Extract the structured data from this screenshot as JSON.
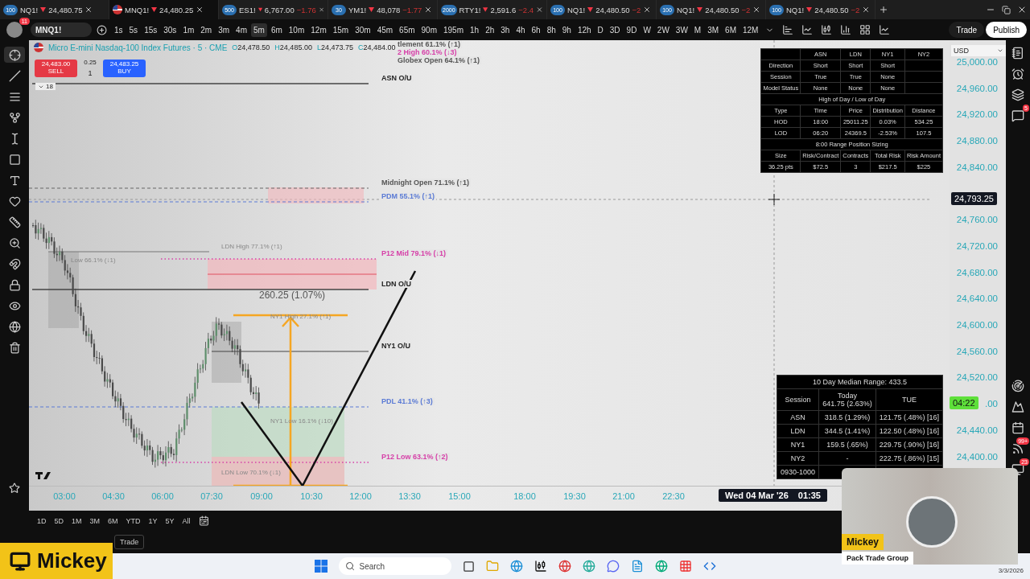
{
  "tabs": [
    {
      "badge": "100",
      "symbol": "NQ1!",
      "price": "24,480.75",
      "selected": false
    },
    {
      "symbol": "MNQ1!",
      "price": "24,480.25",
      "selected": true
    },
    {
      "badge": "500",
      "symbol": "ES1!",
      "price": "6,767.00",
      "change": "−1.76",
      "selected": false
    },
    {
      "badge": "30",
      "symbol": "YM1!",
      "price": "48,078",
      "change": "−1.77",
      "selected": false
    },
    {
      "badge": "2000",
      "symbol": "RTY1!",
      "price": "2,591.6",
      "change": "−2.4",
      "selected": false
    },
    {
      "badge": "100",
      "symbol": "NQ1!",
      "price": "24,480.50",
      "change": "−2",
      "selected": false
    },
    {
      "badge": "100",
      "symbol": "NQ1!",
      "price": "24,480.50",
      "change": "−2",
      "selected": false
    },
    {
      "badge": "100",
      "symbol": "NQ1!",
      "price": "24,480.50",
      "change": "−2",
      "selected": false
    }
  ],
  "toolbar": {
    "avatar_badge": "11",
    "symbol": "MNQ1!",
    "intervals": [
      {
        "label": "1s",
        "selected": false
      },
      {
        "label": "5s",
        "selected": false
      },
      {
        "label": "15s",
        "selected": false
      },
      {
        "label": "30s",
        "selected": false
      },
      {
        "label": "1m",
        "selected": false
      },
      {
        "label": "2m",
        "selected": false
      },
      {
        "label": "3m",
        "selected": false
      },
      {
        "label": "4m",
        "selected": false
      },
      {
        "label": "5m",
        "selected": true
      },
      {
        "label": "6m",
        "selected": false
      },
      {
        "label": "10m",
        "selected": false
      },
      {
        "label": "12m",
        "selected": false
      },
      {
        "label": "15m",
        "selected": false
      },
      {
        "label": "30m",
        "selected": false
      },
      {
        "label": "45m",
        "selected": false
      },
      {
        "label": "65m",
        "selected": false
      },
      {
        "label": "90m",
        "selected": false
      },
      {
        "label": "195m",
        "selected": false
      },
      {
        "label": "1h",
        "selected": false
      },
      {
        "label": "2h",
        "selected": false
      },
      {
        "label": "3h",
        "selected": false
      },
      {
        "label": "4h",
        "selected": false
      },
      {
        "label": "6h",
        "selected": false
      },
      {
        "label": "8h",
        "selected": false
      },
      {
        "label": "9h",
        "selected": false
      },
      {
        "label": "12h",
        "selected": false
      },
      {
        "label": "D",
        "selected": false
      },
      {
        "label": "3D",
        "selected": false
      },
      {
        "label": "9D",
        "selected": false
      },
      {
        "label": "W",
        "selected": false
      },
      {
        "label": "2W",
        "selected": false
      },
      {
        "label": "3W",
        "selected": false
      },
      {
        "label": "M",
        "selected": false
      },
      {
        "label": "3M",
        "selected": false
      },
      {
        "label": "6M",
        "selected": false
      },
      {
        "label": "12M",
        "selected": false
      }
    ],
    "trade": "Trade",
    "publish": "Publish"
  },
  "left_tools": [
    {
      "kind": "crosshair",
      "selected": true
    },
    {
      "kind": "line",
      "selected": false
    },
    {
      "kind": "lines",
      "selected": false
    },
    {
      "kind": "fork",
      "selected": false
    },
    {
      "kind": "cursor",
      "selected": false
    },
    {
      "kind": "shape",
      "selected": false
    },
    {
      "kind": "text",
      "selected": false
    },
    {
      "kind": "heart",
      "selected": false
    },
    {
      "kind": "ruler",
      "selected": false
    },
    {
      "kind": "zoom",
      "selected": false
    },
    {
      "kind": "magnet",
      "selected": false
    },
    {
      "kind": "lock",
      "selected": false
    },
    {
      "kind": "eye",
      "selected": false
    },
    {
      "kind": "globe",
      "selected": false
    },
    {
      "kind": "trash",
      "selected": false
    }
  ],
  "chart": {
    "title": "Micro E-mini Nasdaq-100 Index Futures · 5 · CME",
    "ohlc": [
      {
        "key": "O",
        "value": "24,478.50"
      },
      {
        "key": "H",
        "value": "24,485.00"
      },
      {
        "key": "L",
        "value": "24,473.75"
      },
      {
        "key": "C",
        "value": "24,484.00"
      }
    ],
    "order": {
      "sell_price": "24,483.00",
      "sell_label": "SELL",
      "spread": "0.25",
      "qty": "1",
      "buy_price": "24,483.25",
      "buy_label": "BUY"
    },
    "collapse": "18",
    "levels": [
      {
        "text": "tlement 61.1% (↑1)",
        "color": "#555555"
      },
      {
        "text": "2 High 60.1% (↓3)",
        "color": "#d63fa8"
      },
      {
        "text": "Globex Open 64.1% (↑1)",
        "color": "#555555"
      },
      {
        "text": "ASN O/U",
        "color": "#222222"
      },
      {
        "text": "Midnight Open 71.1% (↑1)",
        "color": "#555555"
      },
      {
        "text": "PDM 55.1% (↑1)",
        "color": "#5b7bd5"
      },
      {
        "text": "P12 Mid 79.1% (↓1)",
        "color": "#d63fa8"
      },
      {
        "text": "LDN O/U",
        "color": "#222222"
      },
      {
        "text": "NY1 O/U",
        "color": "#222222"
      },
      {
        "text": "PDL 41.1% (↑3)",
        "color": "#5b7bd5"
      },
      {
        "text": "P12 Low 63.1% (↑2)",
        "color": "#d63fa8"
      }
    ],
    "session_labels": [
      "LDN High 77.1% (↑1)",
      "Low 66.1% (↓1)",
      "NY1 High 27.1% (↑1)",
      "NY1 Low 16.1% (↓10)",
      "LDN Low 70.1% (↓1)"
    ],
    "measure": "260.25 (1.07%)",
    "stats_table": {
      "rows": [
        {
          "kind": "row",
          "cells": [
            null,
            "ASN",
            "LDN",
            "NY1",
            "NY2"
          ]
        },
        {
          "kind": "row",
          "cells": [
            "Direction",
            "Short",
            "Short",
            "Short",
            null
          ]
        },
        {
          "kind": "row",
          "cells": [
            "Session",
            "True",
            "True",
            "None",
            null
          ]
        },
        {
          "kind": "row",
          "cells": [
            "Model Status",
            "None",
            "None",
            "None",
            null
          ]
        },
        {
          "kind": "title",
          "text": "High of Day / Low of Day"
        },
        {
          "kind": "row",
          "cells": [
            "Type",
            "Time",
            "Price",
            "Distribution",
            "Distance"
          ]
        },
        {
          "kind": "row",
          "cells": [
            "HOD",
            "18:00",
            "25011.25",
            "0.03%",
            "534.25"
          ]
        },
        {
          "kind": "row",
          "cells": [
            "LOD",
            "06:20",
            "24369.5",
            "-2.53%",
            "107.5"
          ]
        },
        {
          "kind": "title",
          "text": "8:00 Range Position Sizing"
        },
        {
          "kind": "row",
          "cells": [
            "Size",
            "Risk/Contract",
            "Contracts",
            "Total Risk",
            "Risk Amount"
          ]
        },
        {
          "kind": "row",
          "cells": [
            "36.25 pts",
            "$72.5",
            "3",
            "$217.5",
            "$225"
          ]
        }
      ]
    },
    "range_table": {
      "title": "10 Day Median Range: 433.5",
      "columns": [
        {
          "label": "Session"
        },
        {
          "label": "Today",
          "sub": "641.75 (2.63%)"
        },
        {
          "label": "TUE"
        }
      ],
      "rows": [
        [
          "ASN",
          "318.5 (1.29%)",
          "121.75 (.48%) [16]"
        ],
        [
          "LDN",
          "344.5 (1.41%)",
          "122.50 (.48%) [16]"
        ],
        [
          "NY1",
          "159.5 (.65%)",
          "229.75 (.90%) [16]"
        ],
        [
          "NY2",
          "-",
          "222.75 (.86%) [15]"
        ],
        [
          "0930-1000"
        ]
      ]
    }
  },
  "price_axis": {
    "currency": "USD",
    "ticks": [
      "25,000.00",
      "24,960.00",
      "24,920.00",
      "24,880.00",
      "24,840.00",
      "24,760.00",
      "24,720.00",
      "24,680.00",
      "24,640.00",
      "24,600.00",
      "24,560.00",
      "24,520.00",
      ".00",
      "24,440.00",
      "24,400.00"
    ],
    "crosshair": "24,793.25",
    "countdown": "04:22"
  },
  "time_axis": {
    "ticks": [
      "03:00",
      "04:30",
      "06:00",
      "07:30",
      "09:00",
      "10:30",
      "12:00",
      "13:30",
      "15:00",
      "18:00",
      "19:30",
      "21:00",
      "22:30"
    ],
    "cursor_date": "Wed 04 Mar '26",
    "cursor_time": "01:35"
  },
  "right_sidebar": {
    "chat_badge": "5",
    "feed_badge": "99+",
    "alerts_badge": "23"
  },
  "ranges": [
    "1D",
    "5D",
    "1M",
    "3M",
    "6M",
    "YTD",
    "1Y",
    "5Y",
    "All"
  ],
  "bottom_trade": "Trade",
  "taskbar": {
    "search": "Search",
    "date": "3/3/2026"
  },
  "overlay": {
    "name": "Mickey"
  },
  "webcam": {
    "name": "Mickey",
    "group": "Pack Trade Group"
  }
}
